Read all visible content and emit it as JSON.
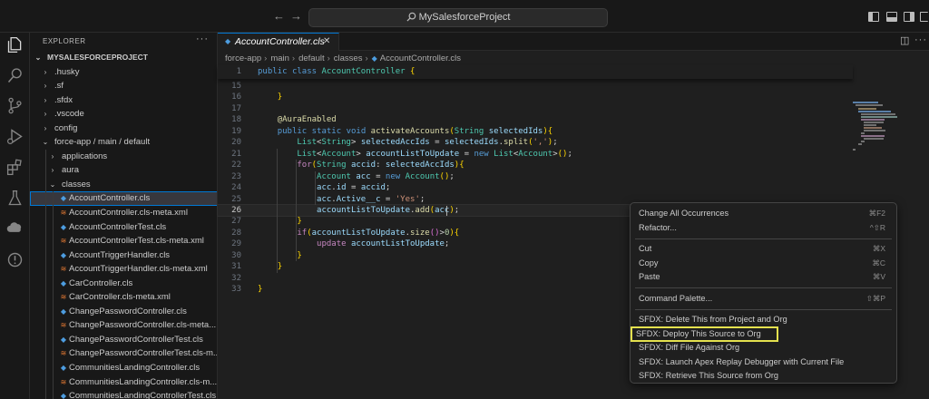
{
  "titlebar": {
    "back": "←",
    "forward": "→",
    "search_text": "MySalesforceProject"
  },
  "sidebar": {
    "title": "EXPLORER",
    "more": "···",
    "tree": [
      {
        "label": "MYSALESFORCEPROJECT",
        "level": 0,
        "chev": "⌄",
        "root": true
      },
      {
        "label": ".husky",
        "level": 1,
        "chev": "›"
      },
      {
        "label": ".sf",
        "level": 1,
        "chev": "›"
      },
      {
        "label": ".sfdx",
        "level": 1,
        "chev": "›"
      },
      {
        "label": ".vscode",
        "level": 1,
        "chev": "›"
      },
      {
        "label": "config",
        "level": 1,
        "chev": "›"
      },
      {
        "label": "force-app / main / default",
        "level": 1,
        "chev": "⌄"
      },
      {
        "label": "applications",
        "level": 2,
        "chev": "›"
      },
      {
        "label": "aura",
        "level": 2,
        "chev": "›"
      },
      {
        "label": "classes",
        "level": 2,
        "chev": "⌄"
      },
      {
        "label": "AccountController.cls",
        "level": 3,
        "icon": "cls",
        "selected": true
      },
      {
        "label": "AccountController.cls-meta.xml",
        "level": 3,
        "icon": "xml"
      },
      {
        "label": "AccountControllerTest.cls",
        "level": 3,
        "icon": "cls"
      },
      {
        "label": "AccountControllerTest.cls-meta.xml",
        "level": 3,
        "icon": "xml"
      },
      {
        "label": "AccountTriggerHandler.cls",
        "level": 3,
        "icon": "cls"
      },
      {
        "label": "AccountTriggerHandler.cls-meta.xml",
        "level": 3,
        "icon": "xml"
      },
      {
        "label": "CarController.cls",
        "level": 3,
        "icon": "cls"
      },
      {
        "label": "CarController.cls-meta.xml",
        "level": 3,
        "icon": "xml"
      },
      {
        "label": "ChangePasswordController.cls",
        "level": 3,
        "icon": "cls"
      },
      {
        "label": "ChangePasswordController.cls-meta....",
        "level": 3,
        "icon": "xml"
      },
      {
        "label": "ChangePasswordControllerTest.cls",
        "level": 3,
        "icon": "cls"
      },
      {
        "label": "ChangePasswordControllerTest.cls-m...",
        "level": 3,
        "icon": "xml"
      },
      {
        "label": "CommunitiesLandingController.cls",
        "level": 3,
        "icon": "cls"
      },
      {
        "label": "CommunitiesLandingController.cls-m...",
        "level": 3,
        "icon": "xml"
      },
      {
        "label": "CommunitiesLandingControllerTest.cls",
        "level": 3,
        "icon": "cls"
      }
    ]
  },
  "editor": {
    "tab_label": "AccountController.cls",
    "tab_close": "✕",
    "breadcrumb": [
      "force-app",
      "main",
      "default",
      "classes",
      "AccountController.cls"
    ],
    "sticky_line": {
      "num": "1",
      "text": "public class AccountController {"
    },
    "lines": [
      {
        "num": "15",
        "text": ""
      },
      {
        "num": "16",
        "text": "    }"
      },
      {
        "num": "17",
        "text": ""
      },
      {
        "num": "18",
        "text": "    @AuraEnabled"
      },
      {
        "num": "19",
        "text": "    public static void activateAccounts(String selectedIds){"
      },
      {
        "num": "20",
        "text": "        List<String> selectedAccIds = selectedIds.split(',');"
      },
      {
        "num": "21",
        "text": "        List<Account> accountListToUpdate = new List<Account>();"
      },
      {
        "num": "22",
        "text": "        for(String accid: selectedAccIds){"
      },
      {
        "num": "23",
        "text": "            Account acc = new Account();"
      },
      {
        "num": "24",
        "text": "            acc.id = accid;"
      },
      {
        "num": "25",
        "text": "            acc.Active__c = 'Yes';"
      },
      {
        "num": "26",
        "text": "            accountListToUpdate.add(acc);"
      },
      {
        "num": "27",
        "text": "        }"
      },
      {
        "num": "28",
        "text": "        if(accountListToUpdate.size()>0){"
      },
      {
        "num": "29",
        "text": "            update accountListToUpdate;"
      },
      {
        "num": "30",
        "text": "        }"
      },
      {
        "num": "31",
        "text": "    }"
      },
      {
        "num": "32",
        "text": ""
      },
      {
        "num": "33",
        "text": "}"
      }
    ]
  },
  "context_menu": {
    "items": [
      {
        "label": "Change All Occurrences",
        "key": "⌘F2"
      },
      {
        "label": "Refactor...",
        "key": "^⇧R"
      },
      {
        "sep": true
      },
      {
        "label": "Cut",
        "key": "⌘X"
      },
      {
        "label": "Copy",
        "key": "⌘C"
      },
      {
        "label": "Paste",
        "key": "⌘V"
      },
      {
        "sep": true
      },
      {
        "label": "Command Palette...",
        "key": "⇧⌘P"
      },
      {
        "sep": true
      },
      {
        "label": "SFDX: Delete This from Project and Org",
        "key": ""
      },
      {
        "label": "SFDX: Deploy This Source to Org",
        "key": "",
        "highlighted": true
      },
      {
        "label": "SFDX: Diff File Against Org",
        "key": ""
      },
      {
        "label": "SFDX: Launch Apex Replay Debugger with Current File",
        "key": ""
      },
      {
        "label": "SFDX: Retrieve This Source from Org",
        "key": ""
      }
    ]
  },
  "colors": {
    "accent": "#0078d4",
    "highlight_box": "#e4e14e",
    "apex_icon": "#4d9de0",
    "xml_icon": "#e37933"
  }
}
